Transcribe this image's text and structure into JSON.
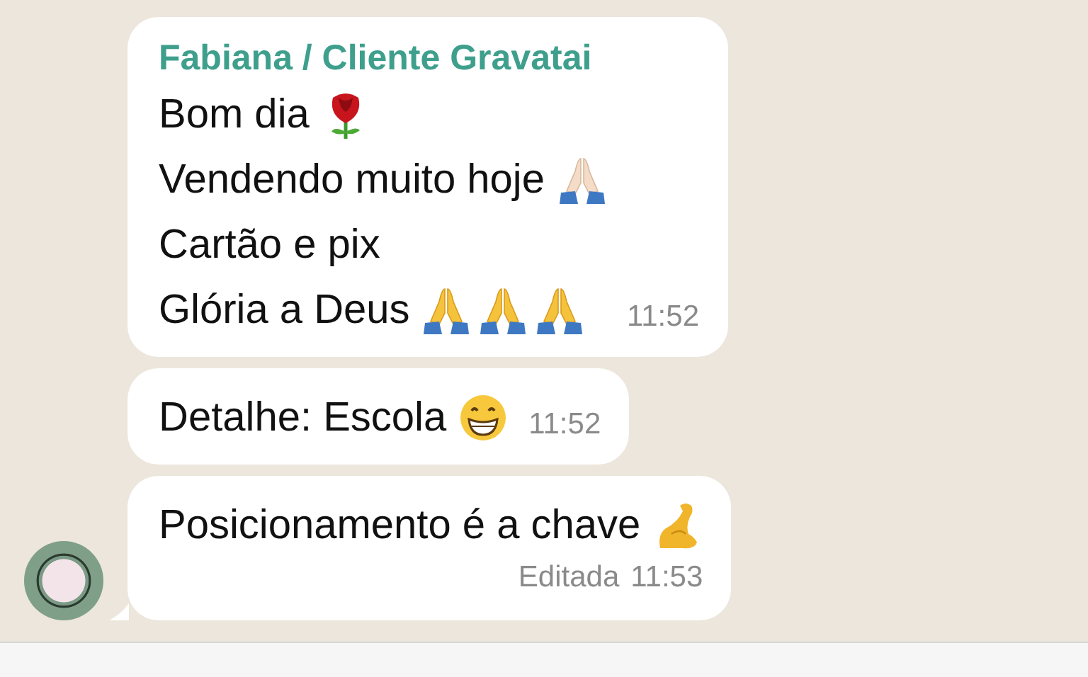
{
  "messages": [
    {
      "sender": "Fabiana / Cliente Gravatai",
      "lines": [
        {
          "text": "Bom dia",
          "emojis": [
            {
              "kind": "rose"
            }
          ]
        },
        {
          "text": "Vendendo muito hoje",
          "emojis": [
            {
              "kind": "praying-hands-light"
            }
          ]
        },
        {
          "text": "Cartão e pix"
        },
        {
          "text": "Glória a Deus",
          "emojis": [
            {
              "kind": "praying-hands"
            },
            {
              "kind": "praying-hands"
            },
            {
              "kind": "praying-hands"
            }
          ]
        }
      ],
      "time": "11:52"
    },
    {
      "lines": [
        {
          "text": "Detalhe: Escola",
          "emojis": [
            {
              "kind": "grinning-face"
            }
          ]
        }
      ],
      "time": "11:52"
    },
    {
      "lines": [
        {
          "text": "Posicionamento é a chave",
          "emojis": [
            {
              "kind": "flexed-arm"
            }
          ]
        }
      ],
      "edited": "Editada",
      "time": "11:53",
      "avatar": true
    }
  ]
}
